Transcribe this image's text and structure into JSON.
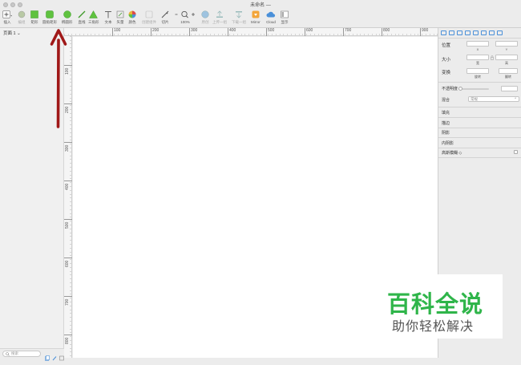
{
  "window": {
    "title": "未命名 —"
  },
  "toolbar": {
    "items": [
      {
        "label": "插入"
      },
      {
        "label": "编组"
      },
      {
        "label": "矩形"
      },
      {
        "label": "圆角矩形"
      },
      {
        "label": "椭圆形"
      },
      {
        "label": "直线"
      },
      {
        "label": "三角形"
      },
      {
        "label": "文本"
      },
      {
        "label": "矢量"
      },
      {
        "label": "颜色"
      },
      {
        "label": "创建组件"
      },
      {
        "label": "切片"
      },
      {
        "label": "100%"
      },
      {
        "label": "原创"
      },
      {
        "label": "上传一组"
      },
      {
        "label": "下载一组"
      },
      {
        "label": "Mirror"
      },
      {
        "label": "Cloud"
      },
      {
        "label": "显示"
      }
    ]
  },
  "left_panel": {
    "pages_label": "页面 1 ⌄",
    "filter_placeholder": "搜索"
  },
  "rulers": {
    "horizontal": [
      "100",
      "200",
      "300",
      "400",
      "500",
      "600",
      "700",
      "800",
      "900"
    ],
    "vertical": [
      "100",
      "200",
      "300",
      "400",
      "500",
      "600",
      "700",
      "800"
    ]
  },
  "inspector": {
    "position_label": "位置",
    "x_label": "X",
    "y_label": "Y",
    "size_label": "大小",
    "width_label": "宽",
    "height_label": "高",
    "transform_label": "变换",
    "rotate_label": "旋转",
    "flip_label": "翻转",
    "opacity_label": "不透明度",
    "blend_label": "混合",
    "blend_value": "常规",
    "sections": [
      "填充",
      "描边",
      "阴影",
      "内阴影",
      "高斯模糊 ◇"
    ]
  },
  "watermark": {
    "title": "百科全说",
    "subtitle": "助你轻松解决"
  },
  "colors": {
    "accent": "#4a90d9",
    "brand_green": "#2fb54a",
    "arrow_red": "#a01818"
  }
}
